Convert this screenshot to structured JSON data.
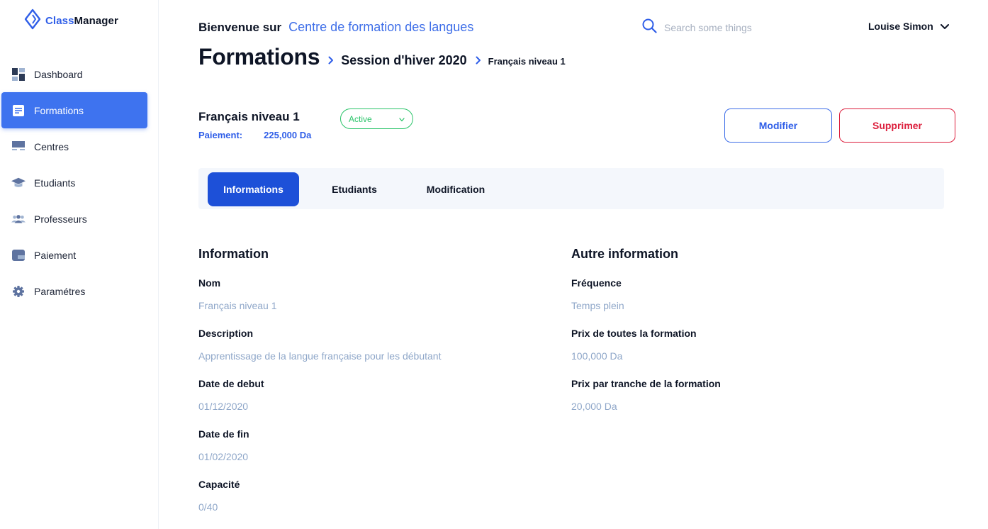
{
  "app": {
    "name_part1": "Class",
    "name_part2": "Manager"
  },
  "sidebar": {
    "items": [
      {
        "label": "Dashboard",
        "icon": "dashboard-icon"
      },
      {
        "label": "Formations",
        "icon": "document-icon",
        "active": true
      },
      {
        "label": "Centres",
        "icon": "building-icon"
      },
      {
        "label": "Etudiants",
        "icon": "graduation-cap-icon"
      },
      {
        "label": "Professeurs",
        "icon": "group-icon"
      },
      {
        "label": "Paiement",
        "icon": "wallet-icon"
      },
      {
        "label": "Paramétres",
        "icon": "gear-icon"
      }
    ]
  },
  "header": {
    "welcome_prefix": "Bienvenue sur",
    "welcome_place": "Centre de formation des langues",
    "search_placeholder": "Search some things",
    "user_name": "Louise Simon"
  },
  "breadcrumb": {
    "level1": "Formations",
    "level2": "Session d'hiver 2020",
    "level3": "Français niveau 1"
  },
  "course": {
    "title": "Français niveau 1",
    "payment_label": "Paiement:",
    "payment_value": "225,000 Da",
    "status": "Active",
    "edit_label": "Modifier",
    "delete_label": "Supprimer"
  },
  "tabs": [
    {
      "label": "Informations",
      "active": true
    },
    {
      "label": "Etudiants"
    },
    {
      "label": "Modification"
    }
  ],
  "info": {
    "title": "Information",
    "fields": [
      {
        "label": "Nom",
        "value": "Français niveau 1"
      },
      {
        "label": "Description",
        "value": "Apprentissage de la langue française pour les débutant"
      },
      {
        "label": "Date de debut",
        "value": "01/12/2020"
      },
      {
        "label": "Date de fin",
        "value": "01/02/2020"
      },
      {
        "label": "Capacité",
        "value": "0/40"
      }
    ]
  },
  "other": {
    "title": "Autre information",
    "fields": [
      {
        "label": "Fréquence",
        "value": "Temps plein"
      },
      {
        "label": "Prix de toutes la formation",
        "value": "100,000 Da"
      },
      {
        "label": "Prix par tranche de la formation",
        "value": "20,000 Da"
      }
    ]
  },
  "colors": {
    "primary": "#3e73ef",
    "active_tab": "#1d50d8",
    "danger": "#dc1e3c",
    "success": "#2bc46a",
    "muted_value": "#8fa7c9"
  }
}
